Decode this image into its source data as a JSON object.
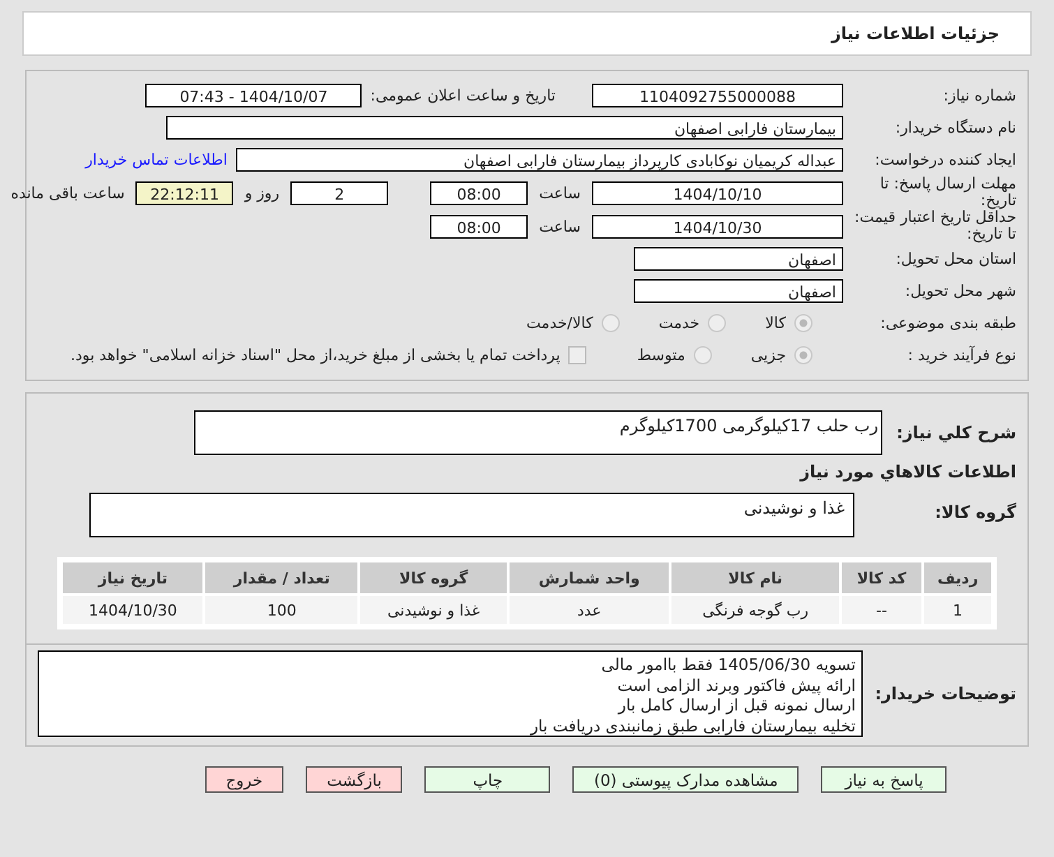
{
  "header": {
    "title": "جزئیات اطلاعات نیاز"
  },
  "info": {
    "need_number": {
      "label": "شماره نیاز:",
      "value": "1104092755000088"
    },
    "announce": {
      "label": "تاریخ و ساعت اعلان عمومی:",
      "value": "1404/10/07 - 07:43"
    },
    "buyer": {
      "label": "نام دستگاه خریدار:",
      "value": "بیمارستان فارابی اصفهان"
    },
    "creator": {
      "label": "ایجاد کننده درخواست:",
      "value": "عبداله کریمیان نوکابادی کارپرداز بیمارستان فارابی اصفهان",
      "link": "اطلاعات تماس خریدار"
    },
    "deadline": {
      "label": "مهلت ارسال پاسخ: تا تاریخ:",
      "date": "1404/10/10",
      "time_label": "ساعت",
      "time": "08:00",
      "days": "2",
      "days_label": "روز و",
      "remaining": "22:12:11",
      "remaining_label": "ساعت باقی مانده"
    },
    "validity": {
      "label": "حداقل تاریخ اعتبار قیمت: تا تاریخ:",
      "date": "1404/10/30",
      "time_label": "ساعت",
      "time": "08:00"
    },
    "province": {
      "label": "استان محل تحویل:",
      "value": "اصفهان"
    },
    "city": {
      "label": "شهر محل تحویل:",
      "value": "اصفهان"
    },
    "category": {
      "label": "طبقه بندی موضوعی:",
      "options": [
        {
          "label": "کالا",
          "selected": true
        },
        {
          "label": "خدمت",
          "selected": false
        },
        {
          "label": "کالا/خدمت",
          "selected": false
        }
      ]
    },
    "process": {
      "label": "نوع فرآیند خرید :",
      "options": [
        {
          "label": "جزیی",
          "selected": true
        },
        {
          "label": "متوسط",
          "selected": false
        }
      ],
      "payment": {
        "checked": false,
        "label": "پرداخت تمام یا بخشی از مبلغ خرید،از محل \"اسناد خزانه اسلامی\" خواهد بود."
      }
    }
  },
  "goods": {
    "summary": {
      "label": "شرح کلي نياز:",
      "value": "رب حلب 17کیلوگرمی 1700کیلوگرم"
    },
    "section_title": "اطلاعات کالاهاي مورد نياز",
    "group": {
      "label": "گروه کالا:",
      "value": "غذا و نوشیدنی"
    },
    "table": {
      "columns": [
        "ردیف",
        "کد کالا",
        "نام کالا",
        "واحد شمارش",
        "گروه کالا",
        "تعداد / مقدار",
        "تاریخ نیاز"
      ],
      "rows": [
        [
          "1",
          "--",
          "رب گوجه فرنگی",
          "عدد",
          "غذا و نوشیدنی",
          "100",
          "1404/10/30"
        ]
      ]
    }
  },
  "notes": {
    "label": "توضیحات خریدار:",
    "lines": [
      "تسویه 1405/06/30 فقط باامور مالی",
      "ارائه پیش فاکتور وبرند الزامی است",
      "ارسال نمونه قبل از ارسال کامل بار",
      "تخلیه بیمارستان فارابی طبق زمانبندی دریافت بار"
    ]
  },
  "buttons": [
    {
      "label": "پاسخ به نیاز",
      "kind": "normal"
    },
    {
      "label": "مشاهده مدارک پیوستی (0)",
      "kind": "normal"
    },
    {
      "label": "چاپ",
      "kind": "normal"
    },
    {
      "label": "بازگشت",
      "kind": "danger"
    },
    {
      "label": "خروج",
      "kind": "danger"
    }
  ]
}
